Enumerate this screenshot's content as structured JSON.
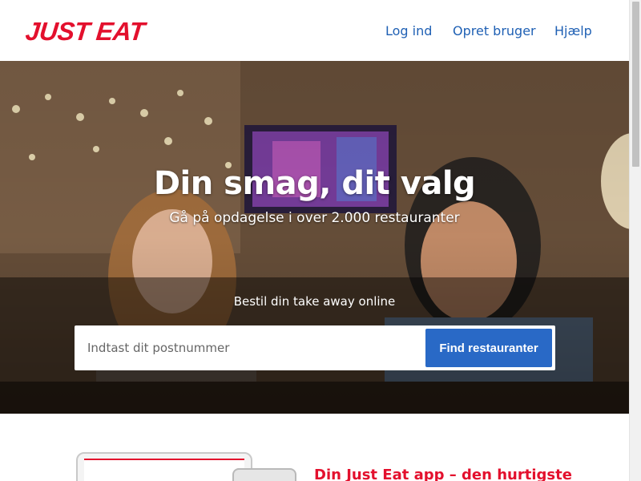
{
  "header": {
    "logo": "JUST EAT",
    "nav": {
      "login": "Log ind",
      "signup": "Opret bruger",
      "help": "Hjælp"
    }
  },
  "hero": {
    "title": "Din smag, dit valg",
    "subtitle": "Gå på opdagelse i over 2.000 restauranter",
    "search_caption": "Bestil din take away online",
    "search": {
      "placeholder": "Indtast dit postnummer",
      "value": "",
      "button_label": "Find restauranter"
    }
  },
  "promo": {
    "title": "Din Just Eat app – den hurtigste"
  },
  "colors": {
    "brand_red": "#e3102d",
    "link_blue": "#1f60b4",
    "button_blue": "#2969c6"
  }
}
